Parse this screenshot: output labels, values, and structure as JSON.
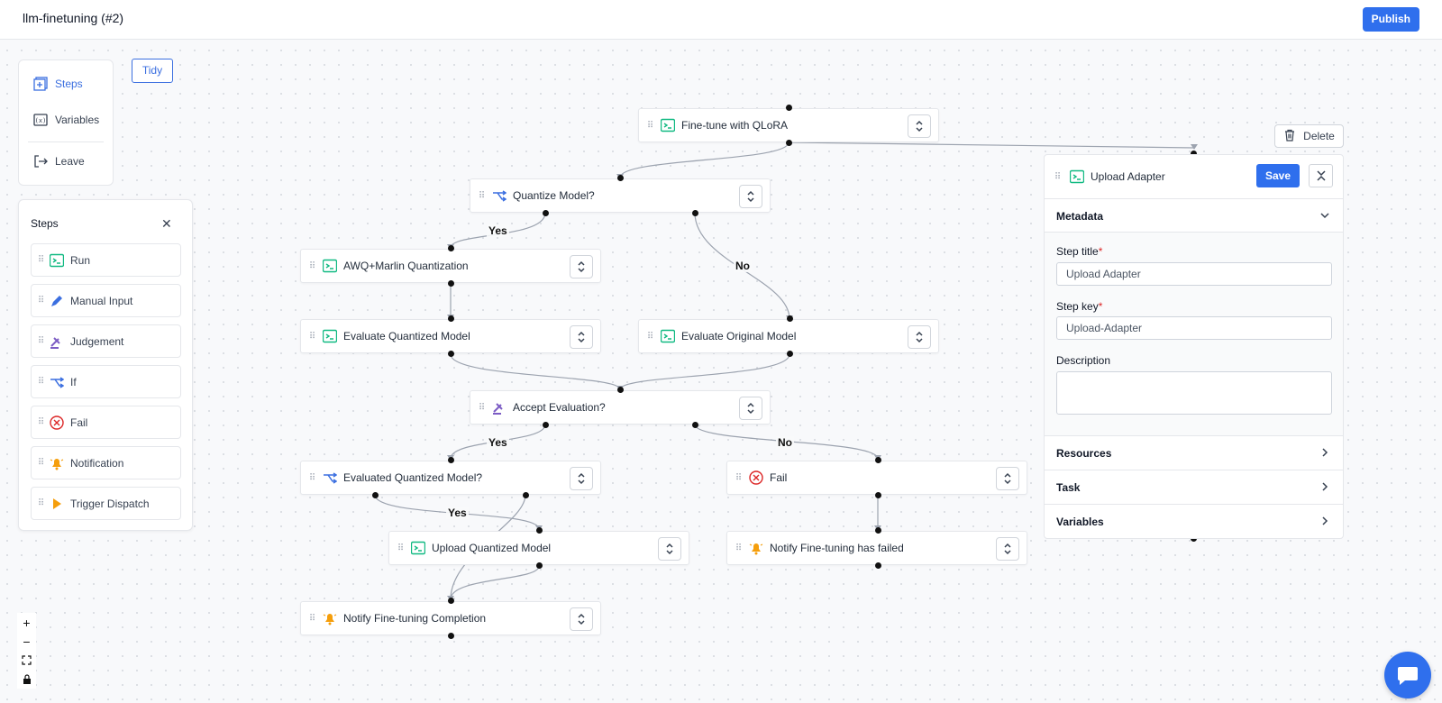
{
  "app": {
    "title": "llm-finetuning (#2)",
    "publish_label": "Publish"
  },
  "toolbar": {
    "tidy_label": "Tidy"
  },
  "nav": {
    "items": [
      {
        "label": "Steps",
        "icon": "steps-icon"
      },
      {
        "label": "Variables",
        "icon": "variables-icon"
      },
      {
        "label": "Leave",
        "icon": "leave-icon"
      }
    ]
  },
  "palette": {
    "title": "Steps",
    "items": [
      {
        "label": "Run",
        "icon": "run-icon"
      },
      {
        "label": "Manual Input",
        "icon": "pencil-icon"
      },
      {
        "label": "Judgement",
        "icon": "judgement-icon"
      },
      {
        "label": "If",
        "icon": "branch-icon"
      },
      {
        "label": "Fail",
        "icon": "fail-icon"
      },
      {
        "label": "Notification",
        "icon": "bell-icon"
      },
      {
        "label": "Trigger Dispatch",
        "icon": "play-icon"
      }
    ]
  },
  "flow": {
    "nodes": [
      {
        "id": "finetune",
        "label": "Fine-tune with QLoRA",
        "icon": "run-icon"
      },
      {
        "id": "quantize",
        "label": "Quantize Model?",
        "icon": "branch-icon"
      },
      {
        "id": "awq",
        "label": "AWQ+Marlin Quantization",
        "icon": "run-icon"
      },
      {
        "id": "evalq",
        "label": "Evaluate Quantized Model",
        "icon": "run-icon"
      },
      {
        "id": "evalo",
        "label": "Evaluate Original Model",
        "icon": "run-icon"
      },
      {
        "id": "accept",
        "label": "Accept Evaluation?",
        "icon": "judgement-icon"
      },
      {
        "id": "evaluatedq",
        "label": "Evaluated Quantized Model?",
        "icon": "branch-icon"
      },
      {
        "id": "fail",
        "label": "Fail",
        "icon": "fail-icon"
      },
      {
        "id": "uploadq",
        "label": "Upload Quantized Model",
        "icon": "run-icon"
      },
      {
        "id": "notifyfail",
        "label": "Notify Fine-tuning has failed",
        "icon": "bell-icon"
      },
      {
        "id": "notifydone",
        "label": "Notify Fine-tuning Completion",
        "icon": "bell-icon"
      }
    ],
    "edge_labels": {
      "yes": "Yes",
      "no": "No"
    }
  },
  "panel": {
    "delete_label": "Delete",
    "step_label": "Upload Adapter",
    "save_label": "Save",
    "metadata_title": "Metadata",
    "step_title_label": "Step title",
    "step_title_value": "Upload Adapter",
    "step_key_label": "Step key",
    "step_key_value": "Upload-Adapter",
    "description_label": "Description",
    "description_value": "",
    "sections": [
      "Resources",
      "Task",
      "Variables"
    ]
  },
  "zoom_controls": [
    "zoom-in",
    "zoom-out",
    "fit-view",
    "lock"
  ],
  "colors": {
    "accent": "#2f6fed",
    "run": "#10b981",
    "branch": "#3b6fe0",
    "judgement": "#7c5cc4",
    "fail": "#dc2626",
    "bell": "#f59e0b"
  }
}
